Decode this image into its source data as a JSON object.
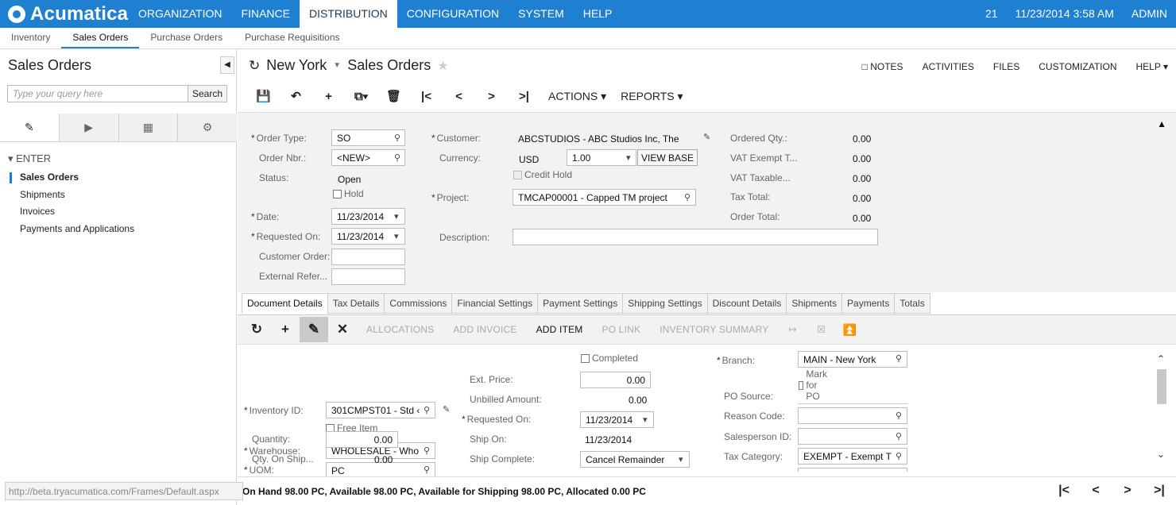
{
  "brand": "Acumatica",
  "top_nav": [
    "ORGANIZATION",
    "FINANCE",
    "DISTRIBUTION",
    "CONFIGURATION",
    "SYSTEM",
    "HELP"
  ],
  "top_nav_active": "DISTRIBUTION",
  "top_right": {
    "count": "21",
    "datetime": "11/23/2014  3:58 AM",
    "user": "ADMIN"
  },
  "sub_nav": [
    "Inventory",
    "Sales Orders",
    "Purchase Orders",
    "Purchase Requisitions"
  ],
  "sub_nav_active": "Sales Orders",
  "left_panel": {
    "title": "Sales Orders",
    "search_placeholder": "Type your query here",
    "search_button": "Search",
    "group": "ENTER",
    "items": [
      "Sales Orders",
      "Shipments",
      "Invoices",
      "Payments and Applications"
    ]
  },
  "header": {
    "location": "New York",
    "screen": "Sales Orders",
    "links": [
      "NOTES",
      "ACTIVITIES",
      "FILES",
      "CUSTOMIZATION",
      "HELP"
    ],
    "actions_menu": "ACTIONS",
    "reports_menu": "REPORTS"
  },
  "form": {
    "order_type_label": "Order Type:",
    "order_type": "SO",
    "order_nbr_label": "Order Nbr.:",
    "order_nbr": "<NEW>",
    "status_label": "Status:",
    "status": "Open",
    "hold_label": "Hold",
    "date_label": "Date:",
    "date": "11/23/2014",
    "requested_on_label": "Requested On:",
    "requested_on": "11/23/2014",
    "customer_order_label": "Customer Order:",
    "external_ref_label": "External Refer...",
    "customer_label": "Customer:",
    "customer": "ABCSTUDIOS - ABC Studios Inc, The",
    "currency_label": "Currency:",
    "currency": "USD",
    "rate": "1.00",
    "view_base": "VIEW BASE",
    "credit_hold_label": "Credit Hold",
    "project_label": "Project:",
    "project": "TMCAP00001 - Capped TM project",
    "description_label": "Description:",
    "ordered_qty_label": "Ordered Qty.:",
    "ordered_qty": "0.00",
    "vat_exempt_label": "VAT Exempt T...",
    "vat_exempt": "0.00",
    "vat_taxable_label": "VAT Taxable...",
    "vat_taxable": "0.00",
    "tax_total_label": "Tax Total:",
    "tax_total": "0.00",
    "order_total_label": "Order Total:",
    "order_total": "0.00"
  },
  "doc_tabs": [
    "Document Details",
    "Tax Details",
    "Commissions",
    "Financial Settings",
    "Payment Settings",
    "Shipping Settings",
    "Discount Details",
    "Shipments",
    "Payments",
    "Totals"
  ],
  "doc_tab_active": "Document Details",
  "grid_toolbar": {
    "allocations": "ALLOCATIONS",
    "add_invoice": "ADD INVOICE",
    "add_item": "ADD ITEM",
    "po_link": "PO LINK",
    "inventory_summary": "INVENTORY SUMMARY"
  },
  "line": {
    "inventory_id_label": "Inventory ID:",
    "inventory_id": "301CMPST01 - Std ‹",
    "free_item_label": "Free Item",
    "warehouse_label": "Warehouse:",
    "warehouse": "WHOLESALE - Who",
    "uom_label": "UOM:",
    "uom": "PC",
    "quantity_label": "Quantity:",
    "quantity": "0.00",
    "qty_on_ship_label": "Qty. On Ship...",
    "qty_on_ship": "0.00",
    "completed_label": "Completed",
    "ext_price_label": "Ext. Price:",
    "ext_price": "0.00",
    "unbilled_label": "Unbilled Amount:",
    "unbilled": "0.00",
    "requested_on_label": "Requested On:",
    "requested_on": "11/23/2014",
    "ship_on_label": "Ship On:",
    "ship_on": "11/23/2014",
    "ship_complete_label": "Ship Complete:",
    "ship_complete": "Cancel Remainder",
    "branch_label": "Branch:",
    "branch": "MAIN - New York",
    "mark_for_po_label": "Mark for PO",
    "po_source_label": "PO Source:",
    "reason_code_label": "Reason Code:",
    "salesperson_label": "Salesperson ID:",
    "tax_category_label": "Tax Category:",
    "tax_category": "EXEMPT - Exempt T"
  },
  "status_bar": "On Hand 98.00 PC, Available 98.00 PC, Available for Shipping 98.00 PC, Allocated 0.00 PC",
  "url_tooltip": "http://beta.tryacumatica.com/Frames/Default.aspx"
}
